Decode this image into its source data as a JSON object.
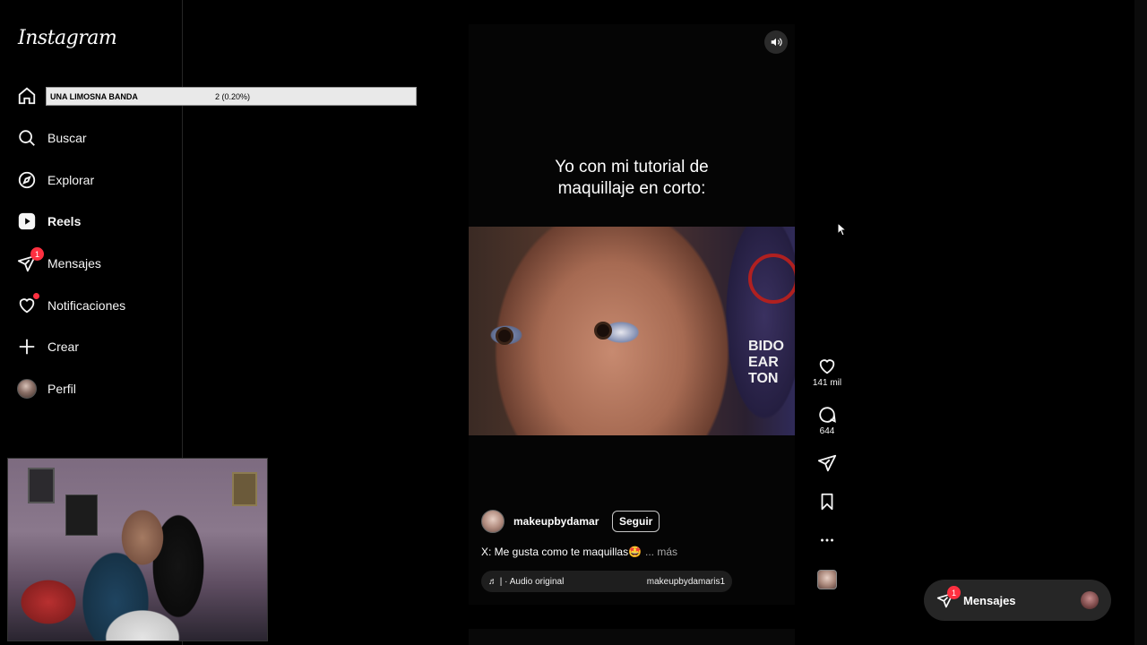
{
  "app": {
    "logo": "Instagram"
  },
  "sidebar": {
    "items": [
      {
        "label": "",
        "icon": "home-icon"
      },
      {
        "label": "Buscar",
        "icon": "search-icon"
      },
      {
        "label": "Explorar",
        "icon": "compass-icon"
      },
      {
        "label": "Reels",
        "icon": "reels-icon",
        "active": true
      },
      {
        "label": "Mensajes",
        "icon": "send-icon",
        "badge": "1"
      },
      {
        "label": "Notificaciones",
        "icon": "heart-icon",
        "dot": true
      },
      {
        "label": "Crear",
        "icon": "plus-icon"
      },
      {
        "label": "Perfil",
        "icon": "avatar"
      }
    ]
  },
  "overlay": {
    "name": "UNA LIMOSNA BANDA",
    "count": "2 (0.20%)"
  },
  "reel": {
    "caption_line1": "Yo con mi tutorial de",
    "caption_line2": "maquillaje en corto:",
    "username": "makeupbydamaris",
    "follow_label": "Seguir",
    "description": "X: Me gusta como te maquillas🤩",
    "more_label": "... más",
    "audio_prefix": "♬ | · Audio original",
    "audio_artist": "makeupbydamaris1",
    "likes": "141 mil",
    "comments": "644",
    "sign_text": "BIDO\nEAR\nTON"
  },
  "messages_widget": {
    "label": "Mensajes",
    "badge": "1"
  },
  "colors": {
    "badge": "#ff3040",
    "background": "#000000",
    "panel": "#262626"
  }
}
